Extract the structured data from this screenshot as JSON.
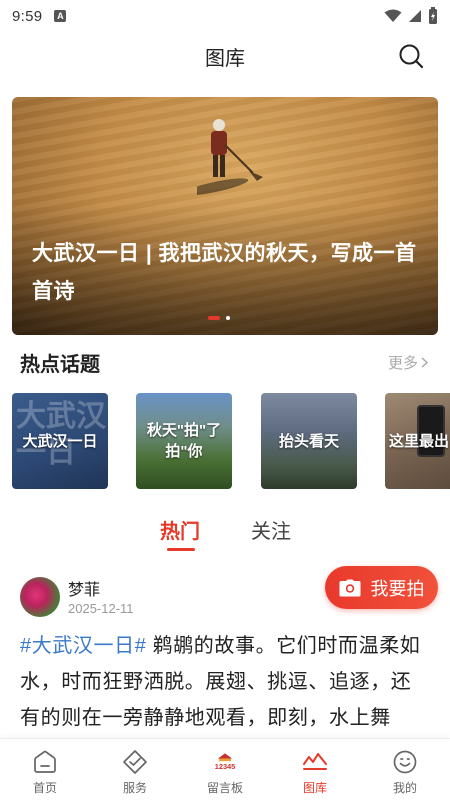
{
  "status_bar": {
    "time": "9:59",
    "notif_glyph": "A"
  },
  "header": {
    "title": "图库",
    "search_icon": "search-icon"
  },
  "banner": {
    "caption": "大武汉一日 | 我把武汉的秋天，写成一首首诗",
    "slide_count": 2,
    "active_slide": 1
  },
  "topics": {
    "title": "热点话题",
    "more_label": "更多",
    "items": [
      {
        "label": "大武汉一日"
      },
      {
        "label": "秋天\"拍\"了\n拍\"你"
      },
      {
        "label": "抬头看天"
      },
      {
        "label": "这里最出"
      }
    ]
  },
  "tabs": {
    "hot": "热门",
    "follow": "关注",
    "active": "hot"
  },
  "post": {
    "author": "梦菲",
    "date": "2025-12-11",
    "shoot_label": "我要拍",
    "hashtag": "#大武汉一日#",
    "text": " 鹈鹕的故事。它们时而温柔如水，时而狂野洒脱。展翅、挑逗、追逐，还有的则在一旁静静地观看，即刻，水上舞"
  },
  "nav": {
    "items": [
      {
        "label": "首页",
        "icon": "home-icon"
      },
      {
        "label": "服务",
        "icon": "service-icon"
      },
      {
        "label": "留言板",
        "icon": "message-board-icon",
        "badge_text": "12345"
      },
      {
        "label": "图库",
        "icon": "gallery-icon"
      },
      {
        "label": "我的",
        "icon": "profile-icon"
      }
    ],
    "active": "图库"
  },
  "colors": {
    "accent": "#e53a2a",
    "hashtag": "#3a78c9"
  }
}
